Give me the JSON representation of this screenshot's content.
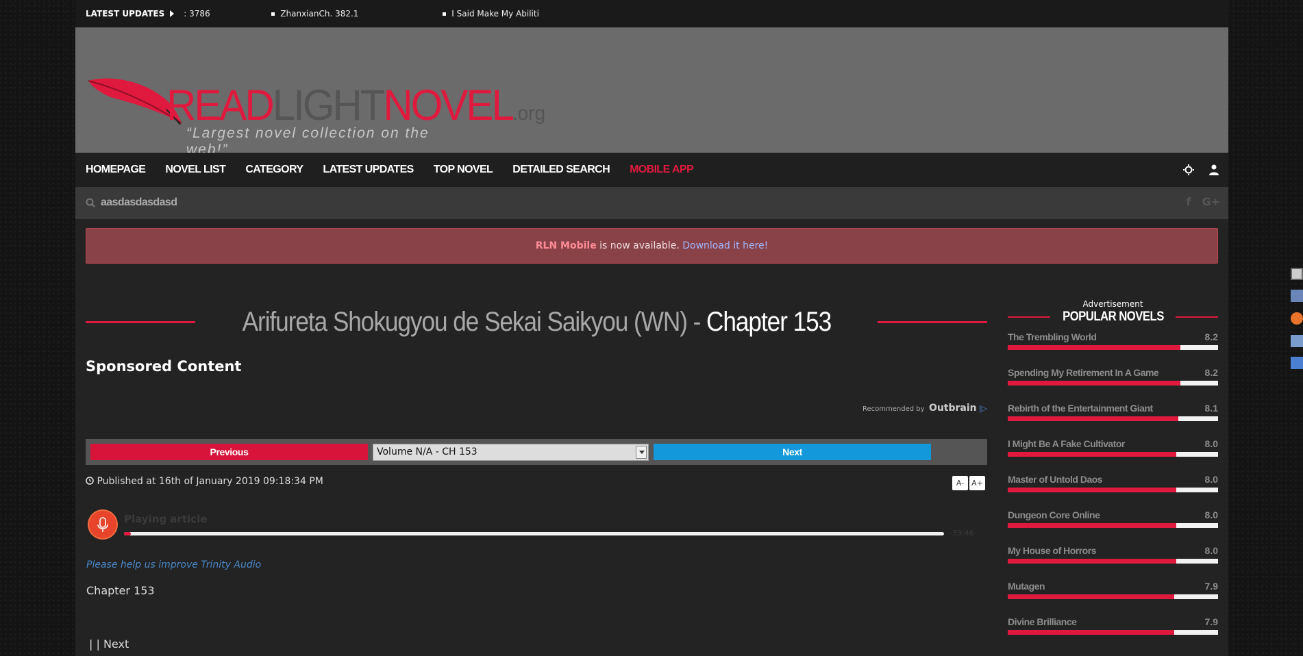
{
  "ticker": {
    "label": "LATEST UPDATES",
    "items": [
      ": 3786",
      "ZhanxianCh. 382.1",
      "I Said Make My Abiliti"
    ]
  },
  "header": {
    "logo_red1": "READ",
    "logo_gray": "LIGHT",
    "logo_red2": "NOVEL",
    "logo_org": ".org",
    "tagline": "“Largest novel collection on the web!”"
  },
  "nav": {
    "items": [
      "HOMEPAGE",
      "NOVEL LIST",
      "CATEGORY",
      "LATEST UPDATES",
      "TOP NOVEL",
      "DETAILED SEARCH"
    ],
    "mobile_app": "MOBILE APP"
  },
  "search": {
    "value": "aasdasdasdasd",
    "social": [
      "f",
      "G+"
    ]
  },
  "alert": {
    "brand": "RLN Mobile",
    "text": " is now available. ",
    "link": "Download it here!"
  },
  "chapter": {
    "novel": "Arifureta Shokugyou de Sekai Saikyou (WN)",
    "separator": " - ",
    "chapter_title": "Chapter 153",
    "sponsored": "Sponsored Content",
    "recommended": "Recommended by",
    "outbrain": "Outbrain",
    "prev": "Previous",
    "next": "Next",
    "select_value": "Volume N/A - CH 153",
    "published": "Published at 16th of January 2019 09:18:34 PM",
    "font_minus": "A-",
    "font_plus": "A+",
    "audio_status": "Playing article",
    "audio_time": "-33:46",
    "audio_progress": 0.008,
    "improve_link": "Please help us improve Trinity Audio",
    "body_first_line": "Chapter 153",
    "bottom_nav": "|  | Next"
  },
  "sidebar": {
    "advertisement": "Advertisement",
    "heading": "POPULAR NOVELS",
    "novels": [
      {
        "name": "The Trembling World",
        "score": "8.2",
        "rating": 8.2
      },
      {
        "name": "Spending My Retirement In A Game",
        "score": "8.2",
        "rating": 8.2
      },
      {
        "name": "Rebirth of the Entertainment Giant",
        "score": "8.1",
        "rating": 8.1
      },
      {
        "name": "I Might Be A Fake Cultivator",
        "score": "8.0",
        "rating": 8.0
      },
      {
        "name": "Master of Untold Daos",
        "score": "8.0",
        "rating": 8.0
      },
      {
        "name": "Dungeon Core Online",
        "score": "8.0",
        "rating": 8.0
      },
      {
        "name": "My House of Horrors",
        "score": "8.0",
        "rating": 8.0
      },
      {
        "name": "Mutagen",
        "score": "7.9",
        "rating": 7.9
      },
      {
        "name": "Divine Brilliance",
        "score": "7.9",
        "rating": 7.9
      }
    ]
  },
  "colors": {
    "accent_red": "#e01a3e",
    "next_blue": "#1298db",
    "page_bg": "#232323"
  }
}
